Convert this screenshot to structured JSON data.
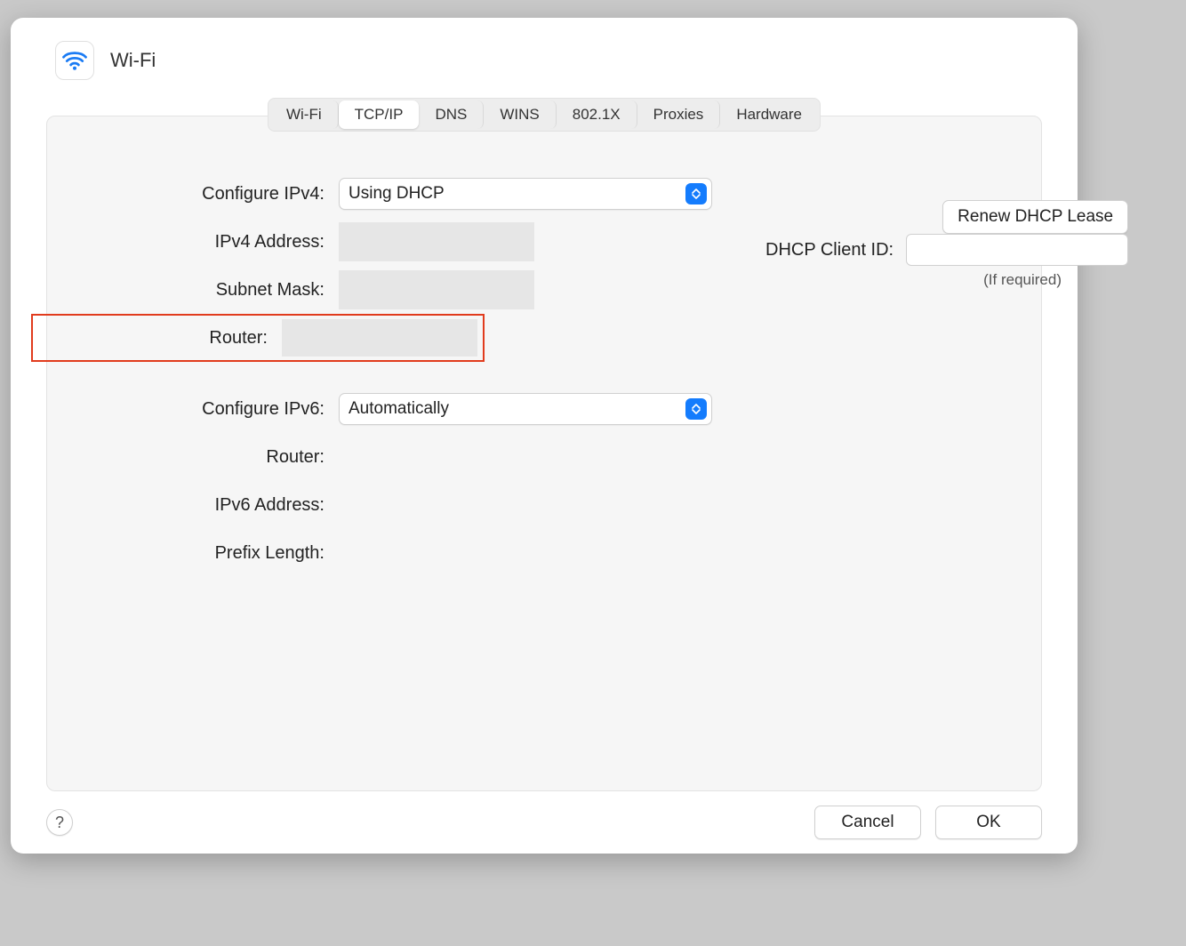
{
  "header": {
    "title": "Wi-Fi"
  },
  "tabs": {
    "wifi": "Wi-Fi",
    "tcpip": "TCP/IP",
    "dns": "DNS",
    "wins": "WINS",
    "dot1x": "802.1X",
    "proxies": "Proxies",
    "hardware": "Hardware",
    "active": "tcpip"
  },
  "ipv4": {
    "configure_label": "Configure IPv4:",
    "configure_value": "Using DHCP",
    "address_label": "IPv4 Address:",
    "address_value": "",
    "subnet_label": "Subnet Mask:",
    "subnet_value": "",
    "router_label": "Router:",
    "router_value": ""
  },
  "ipv6": {
    "configure_label": "Configure IPv6:",
    "configure_value": "Automatically",
    "router_label": "Router:",
    "address_label": "IPv6 Address:",
    "prefix_label": "Prefix Length:"
  },
  "dhcp": {
    "renew_label": "Renew DHCP Lease",
    "client_id_label": "DHCP Client ID:",
    "client_id_value": "",
    "hint": "(If required)"
  },
  "footer": {
    "help": "?",
    "cancel": "Cancel",
    "ok": "OK"
  }
}
